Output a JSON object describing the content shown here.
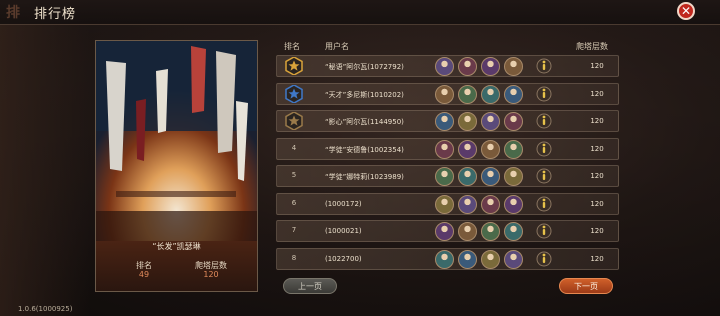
{
  "window": {
    "title": "排行榜",
    "title_deco": "排",
    "close_icon": "close-icon"
  },
  "left_panel": {
    "champion_name": "“长发”凯瑟琳",
    "rank_label": "排名",
    "rank_value": "49",
    "floor_label": "爬塔层数",
    "floor_value": "120"
  },
  "table": {
    "headers": {
      "rank": "排名",
      "user": "用户名",
      "floor": "爬塔层数"
    },
    "rows": [
      {
        "rank": "1",
        "badge": "gold-star-badge",
        "name": "“秘语”阿尔瓦(1072792)",
        "floor": "120"
      },
      {
        "rank": "2",
        "badge": "blue-star-badge",
        "name": "“天才”多尼斯(1010202)",
        "floor": "120"
      },
      {
        "rank": "3",
        "badge": "bronze-star-badge",
        "name": "“影心”阿尔瓦(1144950)",
        "floor": "120"
      },
      {
        "rank": "4",
        "badge": "",
        "name": "“学徒”安德鲁(1002354)",
        "floor": "120"
      },
      {
        "rank": "5",
        "badge": "",
        "name": "“学徒”娜特莉(1023989)",
        "floor": "120"
      },
      {
        "rank": "6",
        "badge": "",
        "name": "(1000172)",
        "floor": "120"
      },
      {
        "rank": "7",
        "badge": "",
        "name": "(1000021)",
        "floor": "120"
      },
      {
        "rank": "8",
        "badge": "",
        "name": "(1022700)",
        "floor": "120"
      }
    ]
  },
  "pagination": {
    "prev": "上一页",
    "next": "下一页"
  },
  "version": "1.0.6(1000925)",
  "colors": {
    "accent_orange": "#d0602a",
    "close_red": "#c0281e",
    "value_orange": "#e08a5b"
  }
}
